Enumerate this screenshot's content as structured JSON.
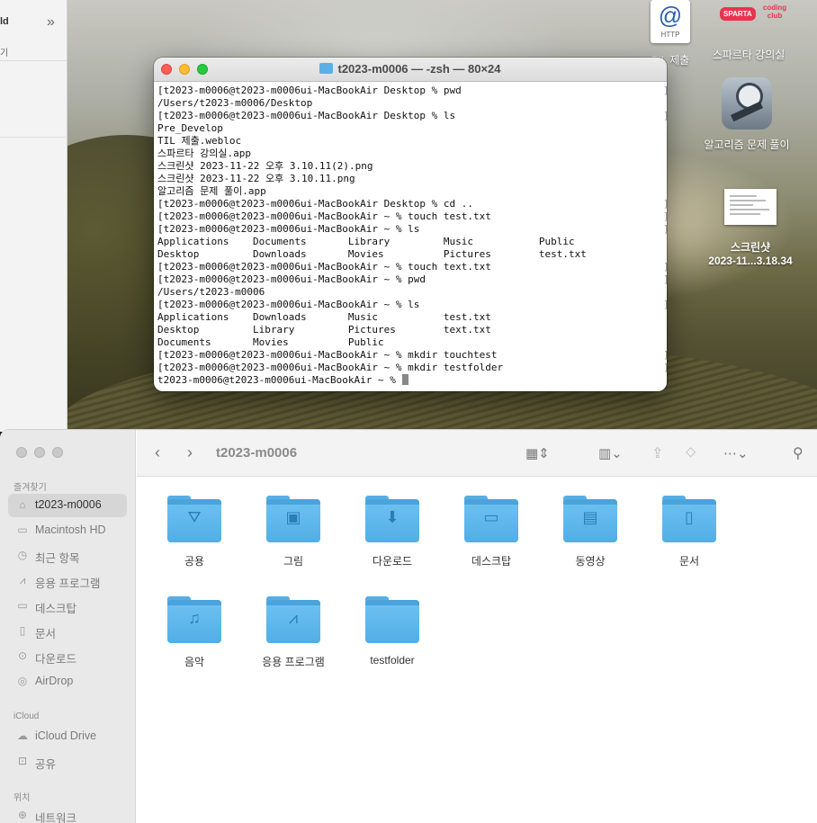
{
  "background_window": {
    "title_fragment": "ld",
    "sub_fragment": "기"
  },
  "desktop_icons": {
    "http": {
      "icon_text": "@",
      "icon_sub": "HTTP",
      "label": "TIL 제출"
    },
    "sparta": {
      "pill": "SPARTA",
      "coding_club": "coding club",
      "label": "스파르타 강의실"
    },
    "algo": {
      "label": "알고리즘 문제 풀이"
    },
    "screenshot": {
      "line1": "스크린샷",
      "line2": "2023-11...3.18.34"
    }
  },
  "terminal": {
    "title": "t2023-m0006 — -zsh — 80×24",
    "lines": [
      {
        "text": "[t2023-m0006@t2023-m0006ui-MacBookAir Desktop % pwd",
        "bracket": "]"
      },
      {
        "text": "/Users/t2023-m0006/Desktop",
        "bracket": ""
      },
      {
        "text": "[t2023-m0006@t2023-m0006ui-MacBookAir Desktop % ls",
        "bracket": "]"
      },
      {
        "text": "Pre_Develop",
        "bracket": ""
      },
      {
        "text": "TIL 제출.webloc",
        "bracket": ""
      },
      {
        "text": "스파르타 강의실.app",
        "bracket": ""
      },
      {
        "text": "스크린샷 2023-11-22 오후 3.10.11(2).png",
        "bracket": ""
      },
      {
        "text": "스크린샷 2023-11-22 오후 3.10.11.png",
        "bracket": ""
      },
      {
        "text": "알고리즘 문제 풀이.app",
        "bracket": ""
      },
      {
        "text": "[t2023-m0006@t2023-m0006ui-MacBookAir Desktop % cd ..",
        "bracket": "]"
      },
      {
        "text": "[t2023-m0006@t2023-m0006ui-MacBookAir ~ % touch test.txt",
        "bracket": "]"
      },
      {
        "text": "[t2023-m0006@t2023-m0006ui-MacBookAir ~ % ls",
        "bracket": "]"
      },
      {
        "text": "Applications    Documents       Library         Music           Public",
        "bracket": ""
      },
      {
        "text": "Desktop         Downloads       Movies          Pictures        test.txt",
        "bracket": ""
      },
      {
        "text": "[t2023-m0006@t2023-m0006ui-MacBookAir ~ % touch text.txt",
        "bracket": "]"
      },
      {
        "text": "[t2023-m0006@t2023-m0006ui-MacBookAir ~ % pwd",
        "bracket": "]"
      },
      {
        "text": "/Users/t2023-m0006",
        "bracket": ""
      },
      {
        "text": "[t2023-m0006@t2023-m0006ui-MacBookAir ~ % ls",
        "bracket": "]"
      },
      {
        "text": "Applications    Downloads       Music           test.txt",
        "bracket": ""
      },
      {
        "text": "Desktop         Library         Pictures        text.txt",
        "bracket": ""
      },
      {
        "text": "Documents       Movies          Public",
        "bracket": ""
      },
      {
        "text": "[t2023-m0006@t2023-m0006ui-MacBookAir ~ % mkdir touchtest",
        "bracket": "]"
      },
      {
        "text": "[t2023-m0006@t2023-m0006ui-MacBookAir ~ % mkdir testfolder",
        "bracket": "]"
      }
    ],
    "prompt": "t2023-m0006@t2023-m0006ui-MacBookAir ~ % "
  },
  "finder": {
    "title": "t2023-m0006",
    "sidebar": {
      "favorites_header": "즐겨찾기",
      "favorites": [
        {
          "label": "t2023-m0006",
          "icon": "home-icon",
          "active": true
        },
        {
          "label": "Macintosh HD",
          "icon": "disk-icon"
        },
        {
          "label": "최근 항목",
          "icon": "clock-icon"
        },
        {
          "label": "응용 프로그램",
          "icon": "apps-icon"
        },
        {
          "label": "데스크탑",
          "icon": "desktop-icon"
        },
        {
          "label": "문서",
          "icon": "document-icon"
        },
        {
          "label": "다운로드",
          "icon": "download-icon"
        },
        {
          "label": "AirDrop",
          "icon": "airdrop-icon"
        }
      ],
      "icloud_header": "iCloud",
      "icloud": [
        {
          "label": "iCloud Drive",
          "icon": "cloud-icon"
        },
        {
          "label": "공유",
          "icon": "shared-folder-icon"
        }
      ],
      "locations_header": "위치",
      "locations": [
        {
          "label": "네트워크",
          "icon": "network-icon"
        }
      ]
    },
    "folders": [
      {
        "name": "공용",
        "icon": "public-glyph-icon",
        "glyph": "⛛"
      },
      {
        "name": "그림",
        "icon": "pictures-glyph-icon",
        "glyph": "▣"
      },
      {
        "name": "다운로드",
        "icon": "download-glyph-icon",
        "glyph": "⬇"
      },
      {
        "name": "데스크탑",
        "icon": "desktop-glyph-icon",
        "glyph": "▭"
      },
      {
        "name": "동영상",
        "icon": "movies-glyph-icon",
        "glyph": "▤"
      },
      {
        "name": "문서",
        "icon": "document-glyph-icon",
        "glyph": "▯"
      },
      {
        "name": "음악",
        "icon": "music-glyph-icon",
        "glyph": "♫"
      },
      {
        "name": "응용 프로그램",
        "icon": "apps-glyph-icon",
        "glyph": "⩘"
      },
      {
        "name": "testfolder",
        "icon": "",
        "glyph": ""
      }
    ]
  }
}
